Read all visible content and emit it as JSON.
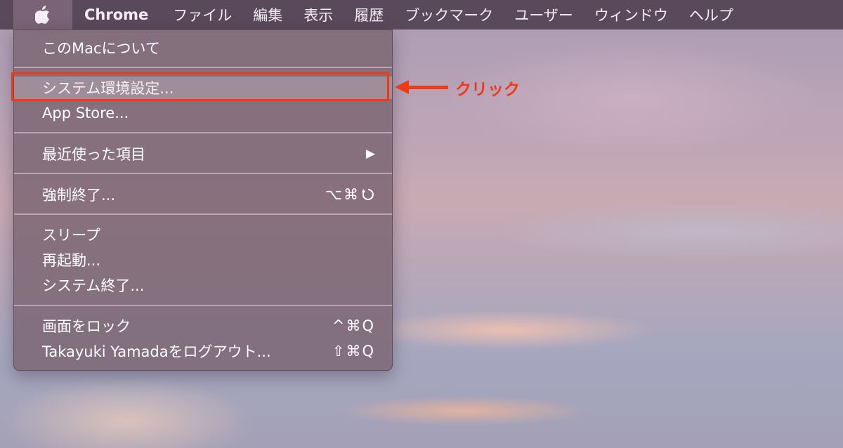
{
  "menubar": {
    "apple_icon": "apple-logo-icon",
    "items": [
      "Chrome",
      "ファイル",
      "編集",
      "表示",
      "履歴",
      "ブックマーク",
      "ユーザー",
      "ウィンドウ",
      "ヘルプ"
    ]
  },
  "apple_menu": {
    "about": "このMacについて",
    "system_prefs": "システム環境設定...",
    "app_store": "App Store...",
    "recent_items": "最近使った項目",
    "recent_items_arrow": "▶",
    "force_quit": "強制終了...",
    "force_quit_shortcut": "⌥⌘",
    "sleep": "スリープ",
    "restart": "再起動...",
    "shutdown": "システム終了...",
    "lock_screen": "画面をロック",
    "lock_screen_shortcut": "^⌘Q",
    "logout": "Takayuki Yamadaをログアウト...",
    "logout_shortcut": "⇧⌘Q"
  },
  "annotation": {
    "label": "クリック",
    "color": "#ee3b16"
  }
}
